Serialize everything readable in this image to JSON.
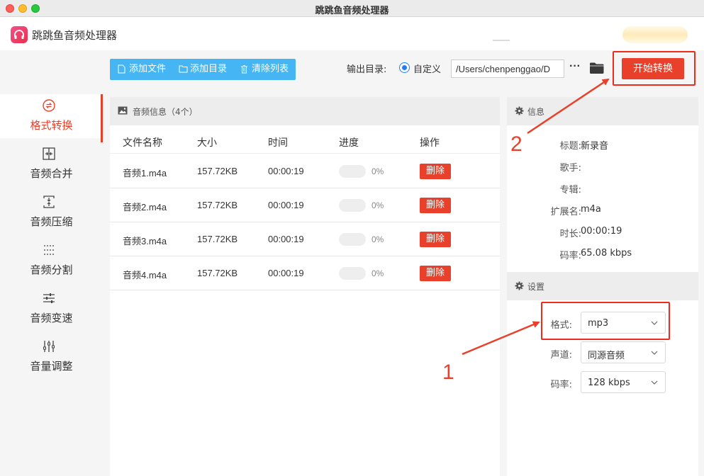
{
  "window": {
    "title": "跳跳鱼音频处理器"
  },
  "app": {
    "name": "跳跳鱼音频处理器"
  },
  "sidebar": {
    "items": [
      {
        "label": "格式转换",
        "icon": "format-convert-icon",
        "active": true
      },
      {
        "label": "音频合并",
        "icon": "merge-icon",
        "active": false
      },
      {
        "label": "音频压缩",
        "icon": "compress-icon",
        "active": false
      },
      {
        "label": "音频分割",
        "icon": "split-icon",
        "active": false
      },
      {
        "label": "音频变速",
        "icon": "speed-icon",
        "active": false
      },
      {
        "label": "音量调整",
        "icon": "volume-icon",
        "active": false
      }
    ]
  },
  "toolbar": {
    "add_file": "添加文件",
    "add_dir": "添加目录",
    "clear_list": "清除列表",
    "output_label": "输出目录:",
    "custom_label": "自定义",
    "output_path": "/Users/chenpenggao/D",
    "more": "···",
    "start": "开始转换"
  },
  "file_panel": {
    "title": "音频信息（4个）",
    "columns": {
      "name": "文件名称",
      "size": "大小",
      "time": "时间",
      "progress": "进度",
      "action": "操作"
    },
    "rows": [
      {
        "name": "音频1.m4a",
        "size": "157.72KB",
        "time": "00:00:19",
        "progress": "0%",
        "action": "删除"
      },
      {
        "name": "音频2.m4a",
        "size": "157.72KB",
        "time": "00:00:19",
        "progress": "0%",
        "action": "删除"
      },
      {
        "name": "音频3.m4a",
        "size": "157.72KB",
        "time": "00:00:19",
        "progress": "0%",
        "action": "删除"
      },
      {
        "name": "音频4.m4a",
        "size": "157.72KB",
        "time": "00:00:19",
        "progress": "0%",
        "action": "删除"
      }
    ]
  },
  "info_panel": {
    "title": "信息",
    "fields": [
      {
        "k": "标题:",
        "v": "新录音"
      },
      {
        "k": "歌手:",
        "v": ""
      },
      {
        "k": "专辑:",
        "v": ""
      },
      {
        "k": "扩展名:",
        "v": "m4a"
      },
      {
        "k": "时长:",
        "v": "00:00:19"
      },
      {
        "k": "码率:",
        "v": "65.08 kbps"
      }
    ]
  },
  "settings_panel": {
    "title": "设置",
    "format_label": "格式:",
    "format_value": "mp3",
    "channel_label": "声道:",
    "channel_value": "同源音频",
    "bitrate_label": "码率:",
    "bitrate_value": "128 kbps"
  },
  "annotations": {
    "step1": "1",
    "step2": "2"
  },
  "colors": {
    "accent": "#e8402a",
    "toolbar_blue": "#45b5f4",
    "radio_blue": "#1e7ff0"
  }
}
